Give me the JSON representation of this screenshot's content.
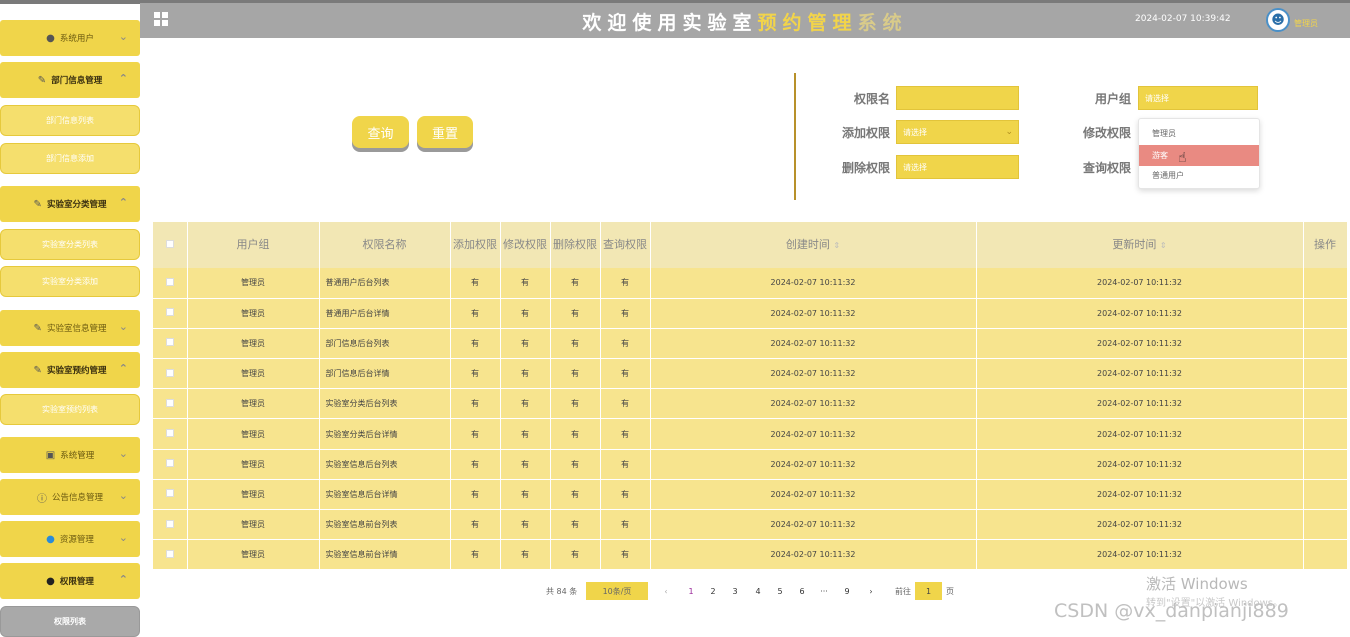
{
  "header": {
    "title_chars": [
      "欢",
      "迎",
      "使",
      "用",
      "实",
      "验",
      "室",
      "预",
      "约",
      "管",
      "理",
      "系",
      "统"
    ],
    "datetime": "2024-02-07 10:39:42",
    "role": "管理员"
  },
  "sidebar": {
    "groups": [
      {
        "label": "系统用户",
        "icon": "user-icon",
        "expanded": false
      },
      {
        "label": "部门信息管理",
        "icon": "edit-icon",
        "expanded": true,
        "children": [
          "部门信息列表",
          "部门信息添加"
        ]
      },
      {
        "label": "实验室分类管理",
        "icon": "edit-icon",
        "expanded": true,
        "children": [
          "实验室分类列表",
          "实验室分类添加"
        ]
      },
      {
        "label": "实验室信息管理",
        "icon": "edit-icon",
        "expanded": false
      },
      {
        "label": "实验室预约管理",
        "icon": "edit-icon",
        "expanded": true,
        "children": [
          "实验室预约列表"
        ]
      },
      {
        "label": "系统管理",
        "icon": "image-icon",
        "expanded": false
      },
      {
        "label": "公告信息管理",
        "icon": "info-icon",
        "expanded": false
      },
      {
        "label": "资源管理",
        "icon": "location-icon",
        "expanded": false
      },
      {
        "label": "权限管理",
        "icon": "user-icon",
        "expanded": true,
        "children": [
          "权限列表"
        ]
      }
    ],
    "active_item": "权限列表"
  },
  "search": {
    "query_label": "查询",
    "reset_label": "重置",
    "fields": {
      "perm_name": {
        "label": "权限名",
        "value": ""
      },
      "user_group": {
        "label": "用户组",
        "value": "请选择"
      },
      "add": {
        "label": "添加权限",
        "value": "请选择"
      },
      "modify": {
        "label": "修改权限",
        "value": ""
      },
      "delete": {
        "label": "删除权限",
        "value": "请选择"
      },
      "query": {
        "label": "查询权限",
        "value": ""
      }
    },
    "dropdown_options": [
      "管理员",
      "游客",
      "普通用户"
    ],
    "hovered_option": "游客"
  },
  "table": {
    "columns": [
      "用户组",
      "权限名称",
      "添加权限",
      "修改权限",
      "删除权限",
      "查询权限",
      "创建时间",
      "更新时间",
      "操作"
    ],
    "rows": [
      {
        "group": "管理员",
        "name": "普通用户后台列表",
        "add": "有",
        "modify": "有",
        "delete": "有",
        "query": "有",
        "created": "2024-02-07 10:11:32",
        "updated": "2024-02-07 10:11:32"
      },
      {
        "group": "管理员",
        "name": "普通用户后台详情",
        "add": "有",
        "modify": "有",
        "delete": "有",
        "query": "有",
        "created": "2024-02-07 10:11:32",
        "updated": "2024-02-07 10:11:32"
      },
      {
        "group": "管理员",
        "name": "部门信息后台列表",
        "add": "有",
        "modify": "有",
        "delete": "有",
        "query": "有",
        "created": "2024-02-07 10:11:32",
        "updated": "2024-02-07 10:11:32"
      },
      {
        "group": "管理员",
        "name": "部门信息后台详情",
        "add": "有",
        "modify": "有",
        "delete": "有",
        "query": "有",
        "created": "2024-02-07 10:11:32",
        "updated": "2024-02-07 10:11:32"
      },
      {
        "group": "管理员",
        "name": "实验室分类后台列表",
        "add": "有",
        "modify": "有",
        "delete": "有",
        "query": "有",
        "created": "2024-02-07 10:11:32",
        "updated": "2024-02-07 10:11:32"
      },
      {
        "group": "管理员",
        "name": "实验室分类后台详情",
        "add": "有",
        "modify": "有",
        "delete": "有",
        "query": "有",
        "created": "2024-02-07 10:11:32",
        "updated": "2024-02-07 10:11:32"
      },
      {
        "group": "管理员",
        "name": "实验室信息后台列表",
        "add": "有",
        "modify": "有",
        "delete": "有",
        "query": "有",
        "created": "2024-02-07 10:11:32",
        "updated": "2024-02-07 10:11:32"
      },
      {
        "group": "管理员",
        "name": "实验室信息后台详情",
        "add": "有",
        "modify": "有",
        "delete": "有",
        "query": "有",
        "created": "2024-02-07 10:11:32",
        "updated": "2024-02-07 10:11:32"
      },
      {
        "group": "管理员",
        "name": "实验室信息前台列表",
        "add": "有",
        "modify": "有",
        "delete": "有",
        "query": "有",
        "created": "2024-02-07 10:11:32",
        "updated": "2024-02-07 10:11:32"
      },
      {
        "group": "管理员",
        "name": "实验室信息前台详情",
        "add": "有",
        "modify": "有",
        "delete": "有",
        "query": "有",
        "created": "2024-02-07 10:11:32",
        "updated": "2024-02-07 10:11:32"
      }
    ]
  },
  "pagination": {
    "total": "共 84 条",
    "page_size": "10条/页",
    "pages": [
      "1",
      "2",
      "3",
      "4",
      "5",
      "6",
      "···",
      "9"
    ],
    "current": "1",
    "goto_label": "前往",
    "goto_value": "1",
    "page_suffix": "页"
  },
  "watermark": {
    "activate": "激活 Windows",
    "activate_sub": "转到\"设置\"以激活 Windows。",
    "csdn": "CSDN @vx_danpianji889"
  }
}
